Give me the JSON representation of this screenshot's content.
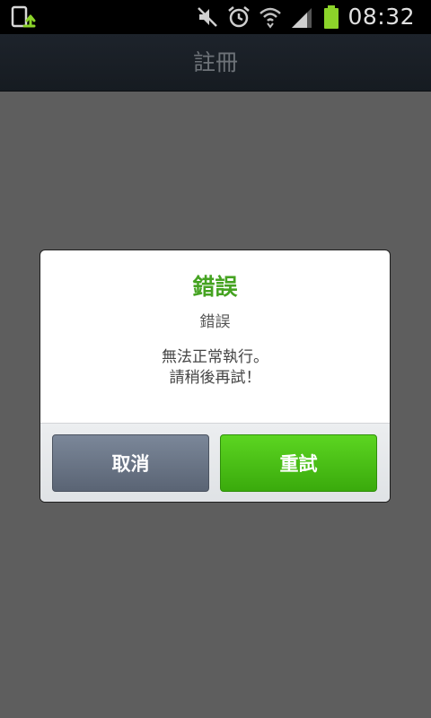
{
  "status_bar": {
    "time": "08:32",
    "icons": [
      "app-update-icon",
      "mute-icon",
      "alarm-icon",
      "wifi-icon",
      "signal-icon",
      "battery-icon"
    ],
    "battery_color": "#8cd42a"
  },
  "header": {
    "title": "註冊"
  },
  "dialog": {
    "title": "錯誤",
    "subtitle": "錯誤",
    "message": "無法正常執行。\n請稍後再試！",
    "cancel_label": "取消",
    "retry_label": "重試",
    "title_color": "#45a321",
    "retry_color": "#4cc61a"
  }
}
